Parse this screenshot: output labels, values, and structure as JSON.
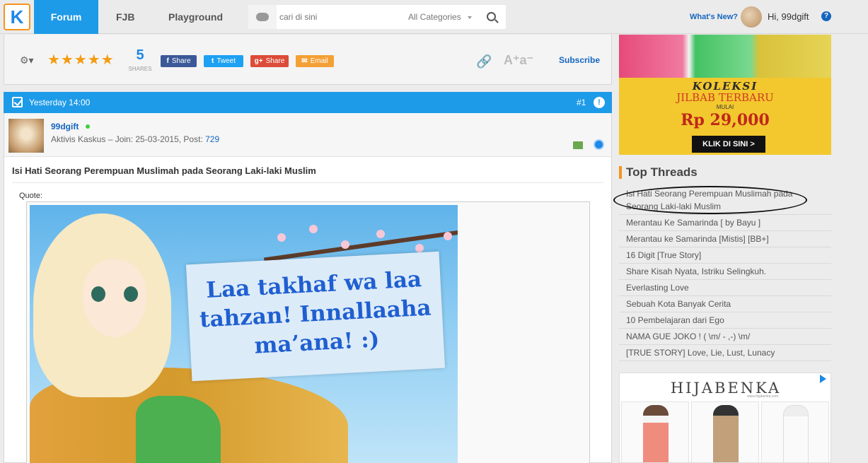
{
  "nav": {
    "logo": "K",
    "forum": "Forum",
    "fjb": "FJB",
    "playground": "Playground",
    "search_placeholder": "cari di sini",
    "category": "All Categories",
    "whats_new": "What's New?",
    "greeting": "Hi, 99dgift",
    "help": "?"
  },
  "share": {
    "rating_stars": "★★★★★",
    "count": "5",
    "count_label": "SHARES",
    "facebook": "Share",
    "twitter": "Tweet",
    "gplus": "Share",
    "email": "Email",
    "font_size": "A⁺a⁻",
    "subscribe": "Subscribe",
    "colors": {
      "facebook": "#3b5998",
      "twitter": "#1da1f2",
      "gplus": "#dd4b39",
      "email": "#f4a036"
    }
  },
  "post": {
    "time": "Yesterday 14:00",
    "number": "#1",
    "alert": "!",
    "username": "99dgift",
    "meta_prefix": "Aktivis Kaskus – Join: 25-03-2015, Post: ",
    "post_count": "729",
    "title": "Isi Hati Seorang Perempuan Muslimah pada Seorang Laki-laki Muslim",
    "quote_label": "Quote:",
    "image_text": "Laa takhaf wa laa tahzan! Innallaaha ma’ana! :)"
  },
  "ads": {
    "koleksi": "KOLEKSI",
    "jilbab": "JILBAB TERBARU",
    "mulai": "MULAI",
    "price": "Rp 29,000",
    "button": "KLIK DI SINI >",
    "hijabenka": "HIJABENKA",
    "hijabenka_tag": "www.hijabenka.com"
  },
  "top_threads": {
    "title": "Top Threads",
    "items": [
      "Isi Hati Seorang Perempuan Muslimah pada Seorang Laki-laki Muslim",
      "Merantau Ke Samarinda [ by Bayu ]",
      "Merantau ke Samarinda [Mistis] [BB+]",
      "16 Digit [True Story]",
      "Share Kisah Nyata, Istriku Selingkuh.",
      "Everlasting Love",
      "Sebuah Kota Banyak Cerita",
      "10 Pembelajaran dari Ego",
      "NAMA GUE JOKO ! ( \\m/ - ,-) \\m/",
      "[TRUE STORY] Love, Lie, Lust, Lunacy"
    ]
  },
  "theme": {
    "accent": "#1e9be8",
    "link": "#1565c0",
    "orange": "#f7941d"
  }
}
